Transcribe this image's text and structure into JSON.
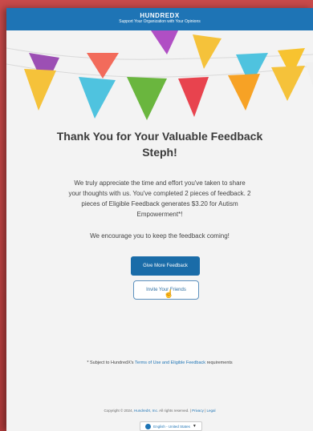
{
  "header": {
    "brand": "HUNDREDX",
    "tagline": "Support Your Organization with Your Opinions"
  },
  "thank_you": {
    "title": "Thank You for Your Valuable Feedback Steph!",
    "message": "We truly appreciate the time and effort you've taken to share your thoughts with us. You've completed 2 pieces of feedback. 2 pieces of Eligible Feedback generates $3.20 for Autism Empowerment*!",
    "encourage": "We encourage you to keep the feedback coming!"
  },
  "buttons": {
    "give_more": "Give More Feedback",
    "invite": "Invite Your Friends"
  },
  "footnote": {
    "prefix": "* Subject to HundredX's",
    "link": "Terms of Use and Eligible Feedback",
    "suffix": "requirements"
  },
  "footer": {
    "copyright": "Copyright © 2024,",
    "company": "HundredX, Inc.",
    "rights": "All rights reserved.",
    "privacy": "Privacy",
    "legal": "Legal",
    "language": "English - United States"
  },
  "colors": {
    "header_bg": "#1e74b5",
    "primary_button": "#1a6ca8"
  }
}
